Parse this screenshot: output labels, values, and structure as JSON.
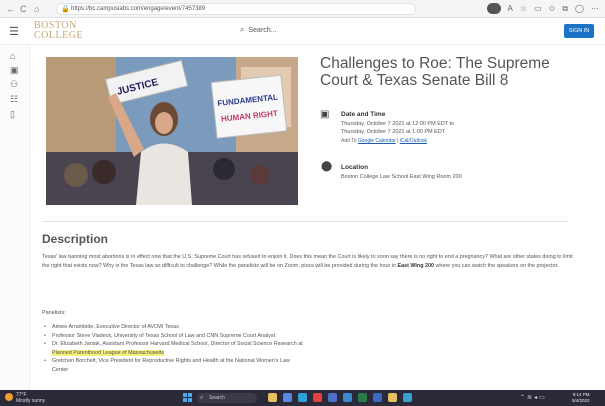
{
  "browser": {
    "back_icon": "←",
    "refresh_icon": "C",
    "home_icon": "⌂",
    "url": "https://bc.campuslabs.com/engage/event/7457389",
    "icons": [
      "tracking",
      "read-aloud",
      "favorites-star",
      "split-screen",
      "favorites",
      "collections",
      "profile",
      "more"
    ]
  },
  "site": {
    "logo_line1": "BOSTON",
    "logo_line2": "COLLEGE",
    "search_placeholder": "Search...",
    "signin_label": "SIGN IN"
  },
  "event": {
    "title": "Challenges to Roe: The Supreme Court & Texas Senate Bill 8",
    "datetime_label": "Date and Time",
    "datetime_line1": "Thursday, October 7 2021 at 12:00 PM EDT to",
    "datetime_line2": "Thursday, October 7 2021 at 1:00 PM EDT",
    "add_to_prefix": "Add To",
    "add_to_google": "Google Calendar",
    "add_to_sep": "|",
    "add_to_ical": "iCal/Outlook",
    "location_label": "Location",
    "location_value": "Boston College Law School East Wing Room 200"
  },
  "description": {
    "heading": "Description",
    "para_before_bold": "Texas' law banning most abortions is in effect now that the U.S. Supreme Court has refused to enjoin it. Does this mean the Court is likely to soon say there is no right to end a pregnancy? What are other states doing to limit the right that exists now? Why is the Texas law so difficult to challenge? While the panelists will be on Zoom, pizza will be provided during the hour in",
    "para_bold": "East Wing 200",
    "para_after_bold": "where you can watch the speakers on the projector.",
    "panelists_label": "Panelists:",
    "panelists": [
      {
        "text": "Aimee Arrambide, Executive Director of AVOW Texas"
      },
      {
        "text": "Professor Steve Vladeck, University of Texas School of Law and CNN Supreme Court Analyst"
      },
      {
        "text": "Dr. Elizabeth Janiak, Assistant Professor Harvard Medical School, Director of Social Science Research at",
        "continuation": "Planned Parenthood League of Massachusetts"
      },
      {
        "text": "Gretchen Borchelt, Vice President for Reproductive Rights and Health at the National Women's Law",
        "continuation": "Center"
      }
    ]
  },
  "hero": {
    "sign1": "JUSTICE",
    "sign2": "FUNDAMENTAL",
    "sign3": "HUMAN RIGHT"
  },
  "taskbar": {
    "temperature": "77°F",
    "weather": "Mostly sunny",
    "search_label": "Search",
    "time": "9:14 PM",
    "date": "5/4/2022"
  },
  "colors": {
    "accent_blue": "#1a73c4",
    "logo_gold": "#c4a779",
    "highlight": "#f7f07a"
  }
}
